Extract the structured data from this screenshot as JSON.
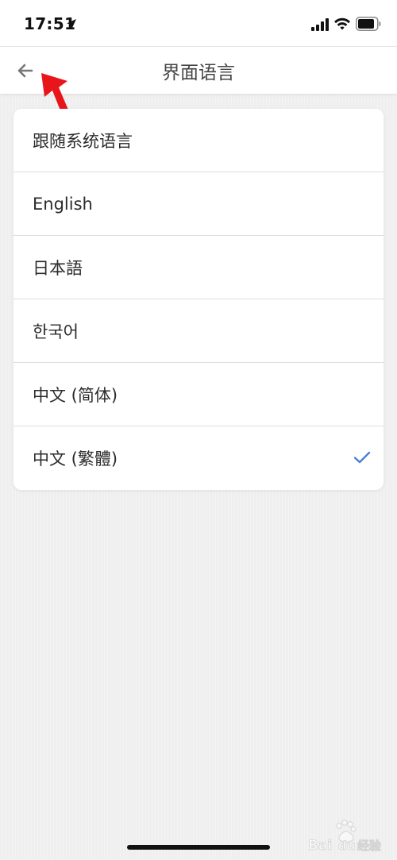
{
  "status_bar": {
    "time": "17:51",
    "icons": [
      "location-arrow-icon",
      "cellular-signal-icon",
      "wifi-icon",
      "battery-icon"
    ]
  },
  "nav": {
    "title": "界面语言",
    "back_icon": "back-arrow-icon"
  },
  "languages": [
    {
      "label": "跟随系统语言",
      "selected": false
    },
    {
      "label": "English",
      "selected": false
    },
    {
      "label": "日本語",
      "selected": false
    },
    {
      "label": "한국어",
      "selected": false
    },
    {
      "label": "中文 (简体)",
      "selected": false
    },
    {
      "label": "中文 (繁體)",
      "selected": true
    }
  ],
  "colors": {
    "accent": "#4a7fd6",
    "annotation": "#e8161b",
    "background": "#efefef"
  },
  "watermark": {
    "text": "Baidu 经验"
  }
}
